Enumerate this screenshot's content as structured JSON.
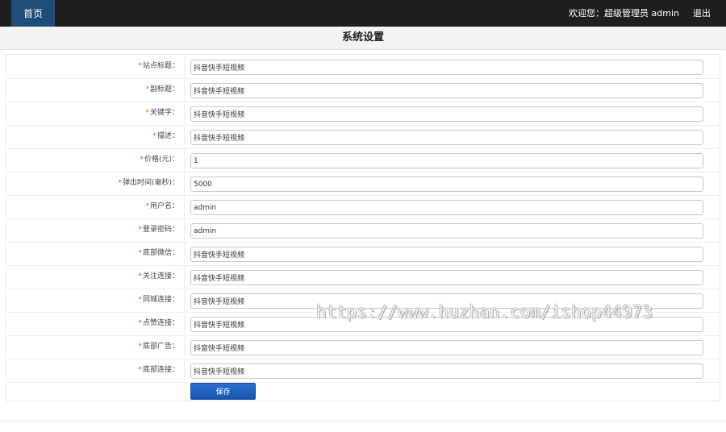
{
  "header": {
    "home_label": "首页",
    "welcome_text": "欢迎您：超级管理员 admin",
    "logout_label": "退出"
  },
  "page": {
    "title": "系统设置"
  },
  "form": {
    "required_mark": "*",
    "fields": [
      {
        "label": "站点标题：",
        "value": "抖音快手短视频"
      },
      {
        "label": "副标题：",
        "value": "抖音快手短视频"
      },
      {
        "label": "关键字：",
        "value": "抖音快手短视频"
      },
      {
        "label": "描述：",
        "value": "抖音快手短视频"
      },
      {
        "label": "价格(元)：",
        "value": "1"
      },
      {
        "label": "弹出时间(毫秒)：",
        "value": "5000"
      },
      {
        "label": "用户名：",
        "value": "admin"
      },
      {
        "label": "登录密码：",
        "value": "admin"
      },
      {
        "label": "底部微信：",
        "value": "抖音快手短视频"
      },
      {
        "label": "关注连接：",
        "value": "抖音快手短视频"
      },
      {
        "label": "同城连接：",
        "value": "抖音快手短视频"
      },
      {
        "label": "点赞连接：",
        "value": "抖音快手短视频"
      },
      {
        "label": "底部广告：",
        "value": "抖音快手短视频"
      },
      {
        "label": "底部连接：",
        "value": "抖音快手短视频"
      }
    ],
    "save_label": "保存"
  },
  "watermark": {
    "text": "https://www.huzhan.com/ishop44973"
  },
  "colors": {
    "topbar_bg": "#1f1f1f",
    "home_tab_bg": "#1f4d7a",
    "required_star": "#e05a2a",
    "save_button": "#1f63c2"
  }
}
